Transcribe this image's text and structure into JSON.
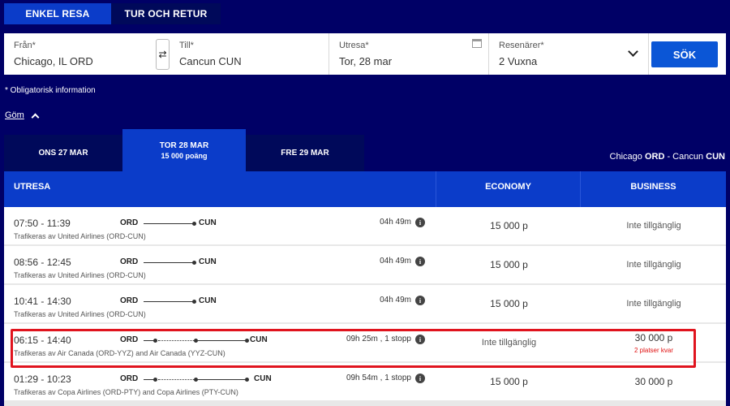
{
  "trip_type": {
    "one_way": "ENKEL RESA",
    "round_trip": "TUR OCH RETUR"
  },
  "search": {
    "from_label": "Från*",
    "from_value": "Chicago, IL ORD",
    "to_label": "Till*",
    "to_value": "Cancun CUN",
    "date_label": "Utresa*",
    "date_value": "Tor, 28 mar",
    "pax_label": "Resenärer*",
    "pax_value": "2 Vuxna",
    "button": "SÖK",
    "swap_icon": "swap-icon",
    "calendar_icon": "calendar-icon",
    "chevron_icon": "chevron-down-icon"
  },
  "required_note": "* Obligatorisk information",
  "hide_link": "Göm",
  "date_tabs": [
    {
      "label": "ONS 27 MAR",
      "sub": ""
    },
    {
      "label": "TOR 28 MAR",
      "sub": "15 000 poäng"
    },
    {
      "label": "FRE 29 MAR",
      "sub": ""
    }
  ],
  "route": {
    "from_city": "Chicago",
    "from_code": "ORD",
    "sep": " - ",
    "to_city": "Cancun",
    "to_code": "CUN"
  },
  "columns": {
    "outbound": "UTRESA",
    "economy": "ECONOMY",
    "business": "BUSINESS"
  },
  "flights": [
    {
      "time": "07:50 - 11:39",
      "operator": "Trafikeras av United Airlines (ORD-CUN)",
      "origin": "ORD",
      "destination": "CUN",
      "duration": "04h 49m",
      "economy": "15 000 p",
      "business": "Inte tillgänglig",
      "business_note": ""
    },
    {
      "time": "08:56 - 12:45",
      "operator": "Trafikeras av United Airlines (ORD-CUN)",
      "origin": "ORD",
      "destination": "CUN",
      "duration": "04h 49m",
      "economy": "15 000 p",
      "business": "Inte tillgänglig",
      "business_note": ""
    },
    {
      "time": "10:41 - 14:30",
      "operator": "Trafikeras av United Airlines (ORD-CUN)",
      "origin": "ORD",
      "destination": "CUN",
      "duration": "04h 49m",
      "economy": "15 000 p",
      "business": "Inte tillgänglig",
      "business_note": ""
    },
    {
      "time": "06:15 - 14:40",
      "operator": "Trafikeras av Air Canada (ORD-YYZ) and Air Canada (YYZ-CUN)",
      "origin": "ORD",
      "destination": "CUN",
      "duration": "09h 25m , 1 stopp",
      "economy": "Inte tillgänglig",
      "business": "30 000 p",
      "business_note": "2 platser kvar"
    },
    {
      "time": "01:29 - 10:23",
      "operator": "Trafikeras av Copa Airlines (ORD-PTY) and Copa Airlines (PTY-CUN)",
      "origin": "ORD",
      "destination": "CUN",
      "duration": "09h 54m , 1 stopp",
      "economy": "15 000 p",
      "business": "30 000 p",
      "business_note": ""
    }
  ],
  "info_icon": "info-icon",
  "colors": {
    "background": "#000066",
    "accent": "#0b3cc9",
    "button": "#0b56d6",
    "highlight": "#e0141e",
    "warning_text": "#e01010"
  }
}
